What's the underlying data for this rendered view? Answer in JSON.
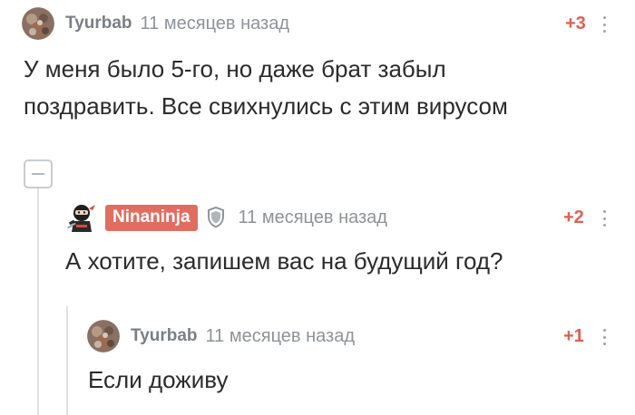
{
  "comments": [
    {
      "username": "Tyurbab",
      "time": "11 месяцев назад",
      "rating": "+3",
      "lines": [
        "У меня было 5-го, но даже брат забыл",
        "поздравить. Все свихнулись с этим вирусом"
      ]
    },
    {
      "username": "Ninaninja",
      "time": "11 месяцев назад",
      "rating": "+2",
      "lines": [
        "А хотите, запишем вас на будущий год?"
      ]
    },
    {
      "username": "Tyurbab",
      "time": "11 месяцев назад",
      "rating": "+1",
      "lines": [
        "Если доживу"
      ]
    }
  ],
  "colors": {
    "rating": "#e15f4f",
    "username": "#7a7f85",
    "badge_bg": "#e16d61",
    "time": "#8e9399"
  },
  "icons": {
    "collapse": "minus-square-icon",
    "menu": "vertical-dots-icon",
    "shield": "shield-icon"
  }
}
